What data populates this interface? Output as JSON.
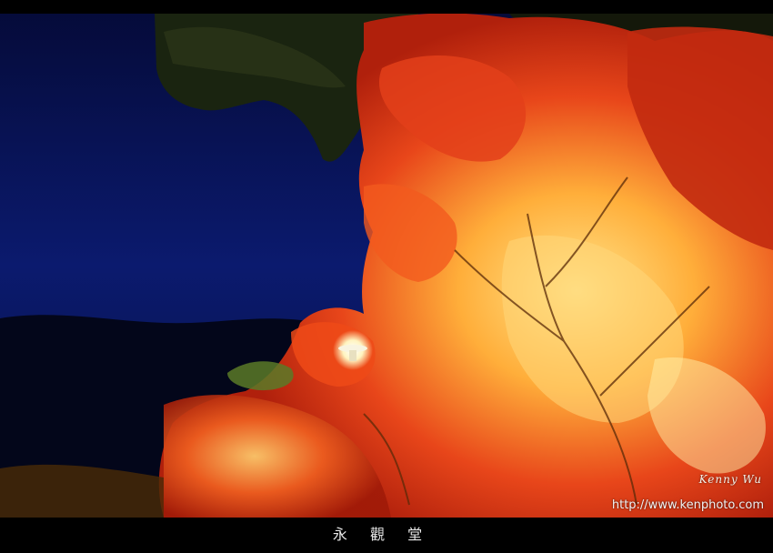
{
  "photo": {
    "sky_color": "#0b1a6e",
    "foliage_colors": [
      "#d82a10",
      "#ff6a20",
      "#ffb040",
      "#ffe07a"
    ],
    "signature": "Kenny Wu",
    "watermark": "http://www.kenphoto.com"
  },
  "caption": {
    "title": "永 觀 堂"
  }
}
